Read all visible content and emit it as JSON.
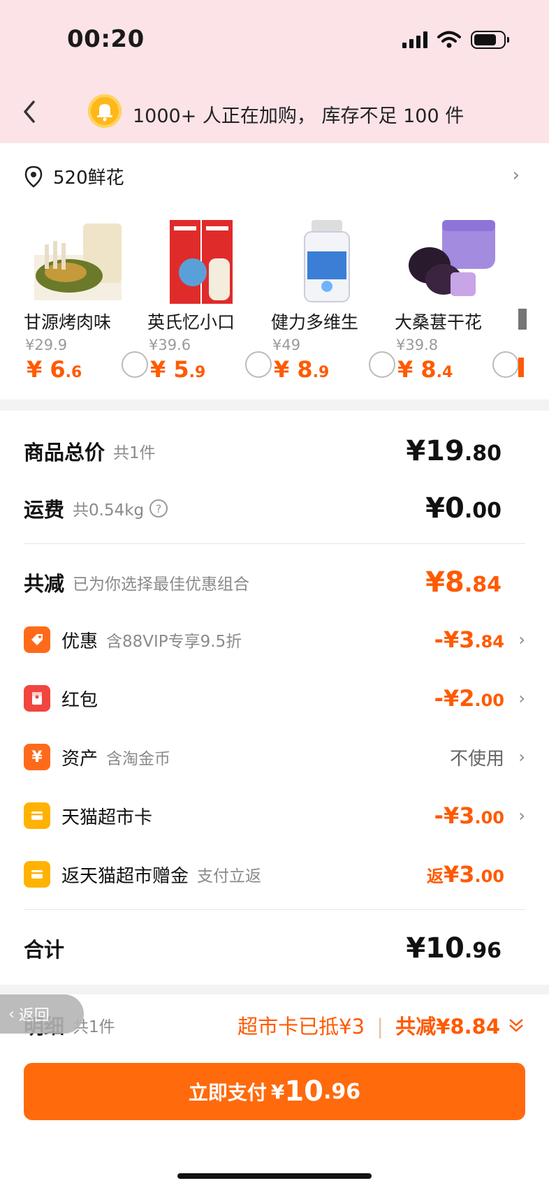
{
  "status_bar": {
    "time": "00:20"
  },
  "header": {
    "notice": "1000+ 人正在加购， 库存不足 100 件"
  },
  "address": {
    "name": "520鲜花"
  },
  "products": [
    {
      "name": "甘源烤肉味",
      "original_price": "¥29.9",
      "price_symbol": "¥",
      "price_int": "6",
      "price_dec": ".6"
    },
    {
      "name": "英氏忆小口",
      "original_price": "¥39.6",
      "price_symbol": "¥",
      "price_int": "5",
      "price_dec": ".9"
    },
    {
      "name": "健力多维生",
      "original_price": "¥49",
      "price_symbol": "¥",
      "price_int": "8",
      "price_dec": ".9"
    },
    {
      "name": "大桑葚干花",
      "original_price": "¥39.8",
      "price_symbol": "¥",
      "price_int": "8",
      "price_dec": ".4"
    }
  ],
  "summary": {
    "goods_total_label": "商品总价",
    "goods_total_sub": "共1件",
    "goods_total_int": "¥19",
    "goods_total_dec": ".80",
    "shipping_label": "运费",
    "shipping_sub": "共0.54kg",
    "shipping_int": "¥0",
    "shipping_dec": ".00",
    "discount_label": "共减",
    "discount_sub": "已为你选择最佳优惠组合",
    "discount_int": "¥8",
    "discount_dec": ".84"
  },
  "items": [
    {
      "label": "优惠",
      "sub": "含88VIP专享9.5折",
      "amount_int": "-¥3",
      "amount_dec": ".84",
      "icon_color": "#ff6a1a"
    },
    {
      "label": "红包",
      "sub": "",
      "amount_int": "-¥2",
      "amount_dec": ".00",
      "icon_color": "#f2453d"
    },
    {
      "label": "资产",
      "sub": "含淘金币",
      "amount_text": "不使用",
      "icon_color": "#ff6a1a"
    },
    {
      "label": "天猫超市卡",
      "sub": "",
      "amount_int": "-¥3",
      "amount_dec": ".00",
      "icon_color": "#ffb200"
    },
    {
      "label": "返天猫超市赠金",
      "sub": "支付立返",
      "amount_prefix": "返",
      "amount_int": "¥3",
      "amount_dec": ".00",
      "icon_color": "#ffb200"
    }
  ],
  "total": {
    "label": "合计",
    "int": "¥10",
    "dec": ".96"
  },
  "detail": {
    "label": "明细",
    "sub": "共1件",
    "card_text": "超市卡已抵¥3",
    "discount_text": "共减¥8.84",
    "back_label": "返回"
  },
  "pay": {
    "label": "立即支付",
    "symbol": "¥",
    "int": "10",
    "dec": ".96"
  }
}
